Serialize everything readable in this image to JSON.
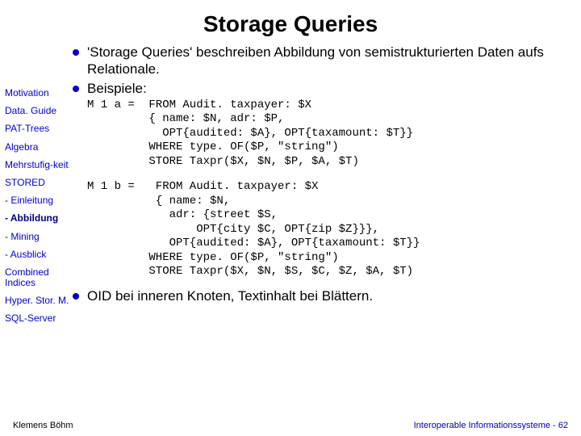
{
  "title": "Storage Queries",
  "sidebar": {
    "items": [
      {
        "label": "Motivation"
      },
      {
        "label": "Data. Guide"
      },
      {
        "label": "PAT-Trees"
      },
      {
        "label": "Algebra"
      },
      {
        "label": "Mehrstufig-keit"
      },
      {
        "label": "STORED"
      },
      {
        "label": "- Einleitung"
      },
      {
        "label": "- Abbildung",
        "active": true
      },
      {
        "label": "- Mining"
      },
      {
        "label": "- Ausblick"
      },
      {
        "label": "Combined Indices"
      },
      {
        "label": "Hyper. Stor. M."
      },
      {
        "label": "SQL-Server"
      }
    ]
  },
  "bullets": {
    "b1": "'Storage Queries' beschreiben Abbildung von semistrukturierten Daten aufs Relationale.",
    "b2": "Beispiele:",
    "b3": "OID bei inneren Knoten, Textinhalt bei Blättern."
  },
  "code": {
    "m1a_label": "M 1 a =",
    "m1a_body": " FROM Audit. taxpayer: $X\n { name: $N, adr: $P,\n   OPT{audited: $A}, OPT{taxamount: $T}}\n WHERE type. OF($P, \"string\")\n STORE Taxpr($X, $N, $P, $A, $T)",
    "m1b_label": "M 1 b =",
    "m1b_body": "  FROM Audit. taxpayer: $X\n  { name: $N,\n    adr: {street $S,\n        OPT{city $C, OPT{zip $Z}}},\n    OPT{audited: $A}, OPT{taxamount: $T}}\n WHERE type. OF($P, \"string\")\n STORE Taxpr($X, $N, $S, $C, $Z, $A, $T)"
  },
  "footer": {
    "left": "Klemens Böhm",
    "right": "Interoperable Informationssysteme - 62"
  }
}
